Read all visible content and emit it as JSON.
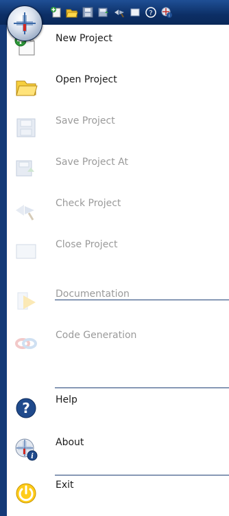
{
  "quick_access": [
    {
      "icon": "new-file-icon"
    },
    {
      "icon": "open-folder-icon"
    },
    {
      "icon": "save-icon"
    },
    {
      "icon": "save-as-icon"
    },
    {
      "icon": "check-icon"
    },
    {
      "icon": "close-icon"
    },
    {
      "icon": "help-icon"
    },
    {
      "icon": "about-icon"
    }
  ],
  "menu": {
    "new_project": "New Project",
    "open_project": "Open Project",
    "save_project": "Save Project",
    "save_project_at": "Save Project At",
    "check_project": "Check Project",
    "close_project": "Close Project",
    "documentation": "Documentation",
    "code_generation": "Code Generation",
    "help": "Help",
    "about": "About",
    "exit": "Exit"
  },
  "colors": {
    "title_bar": "#0c2f66",
    "menu_bg": "#ffffff",
    "label": "#1a1a1a",
    "label_disabled": "#9a9a9a",
    "separator": "#1e3f75"
  }
}
